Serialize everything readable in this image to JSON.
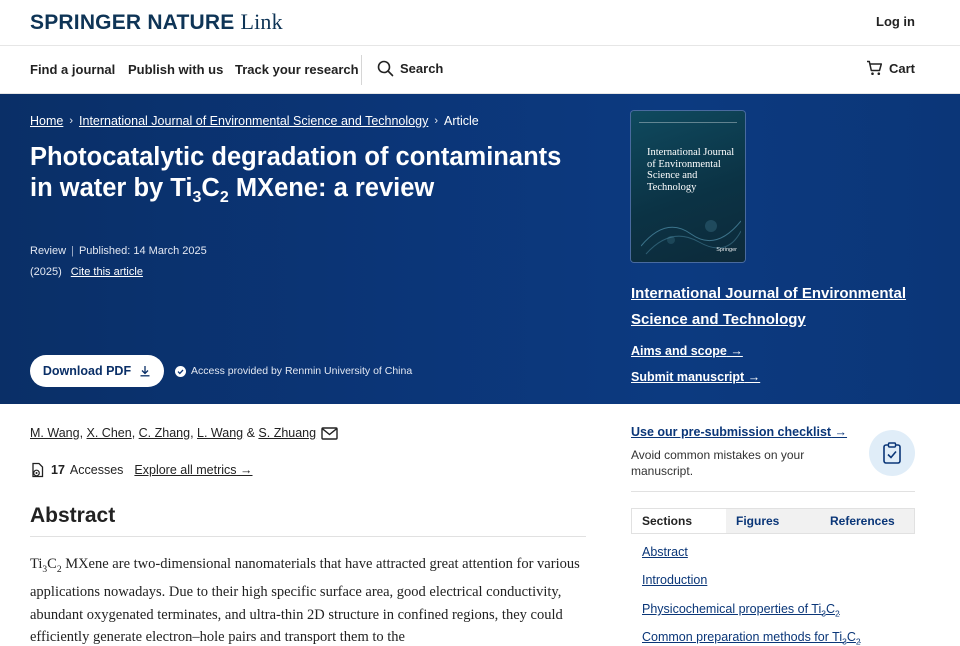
{
  "header": {
    "brand": "SPRINGER NATURE",
    "brand_sub": "Link",
    "login": "Log in"
  },
  "nav": {
    "find_journal": "Find a journal",
    "publish": "Publish with us",
    "track": "Track your research",
    "search": "Search",
    "cart": "Cart"
  },
  "breadcrumb": {
    "home": "Home",
    "journal": "International Journal of Environmental Science and Technology",
    "article": "Article"
  },
  "article": {
    "title_part1": "Photocatalytic degradation of contaminants in water by Ti",
    "title_sub1": "3",
    "title_part2": "C",
    "title_sub2": "2",
    "title_part3": " MXene: a review",
    "type": "Review",
    "published": "Published: 14 March 2025",
    "year": "(2025)",
    "cite": "Cite this article",
    "download_pdf": "Download PDF",
    "access": "Access provided by Renmin University of China",
    "authors": [
      "M. Wang",
      "X. Chen",
      "C. Zhang",
      "L. Wang",
      "S. Zhuang"
    ],
    "accesses_count": "17",
    "accesses_label": "Accesses",
    "explore_metrics": "Explore all metrics",
    "abstract_heading": "Abstract",
    "abstract_ti": "Ti",
    "abstract_sub1": "3",
    "abstract_c": "C",
    "abstract_sub2": "2",
    "abstract_text": " MXene are two-dimensional nanomaterials that have attracted great attention for various applications nowadays. Due to their high specific surface area, good electrical conductivity, abundant oxygenated terminates, and ultra-thin 2D structure in confined regions, they could efficiently generate electron–hole pairs and transport them to the"
  },
  "journal_panel": {
    "cover_title": "International Journal of Environmental Science and Technology",
    "cover_publisher": "Springer",
    "journal_link": "International Journal of Environmental Science and Technology",
    "aims": "Aims and scope",
    "submit": "Submit manuscript",
    "checklist_link": "Use our pre-submission checklist",
    "checklist_text": "Avoid common mistakes on your manuscript."
  },
  "tabs": [
    "Sections",
    "Figures",
    "References"
  ],
  "sections": [
    {
      "label": "Abstract"
    },
    {
      "label": "Introduction"
    },
    {
      "label": "Physicochemical properties of Ti",
      "s1": "3",
      "c": "C",
      "s2": "2"
    },
    {
      "label": "Common preparation methods for Ti",
      "s1": "3",
      "c": "C",
      "s2": "2"
    }
  ],
  "colors": {
    "hero_bg": "#0b3577",
    "link_blue": "#0a3678",
    "brand_navy": "#0e3456"
  }
}
